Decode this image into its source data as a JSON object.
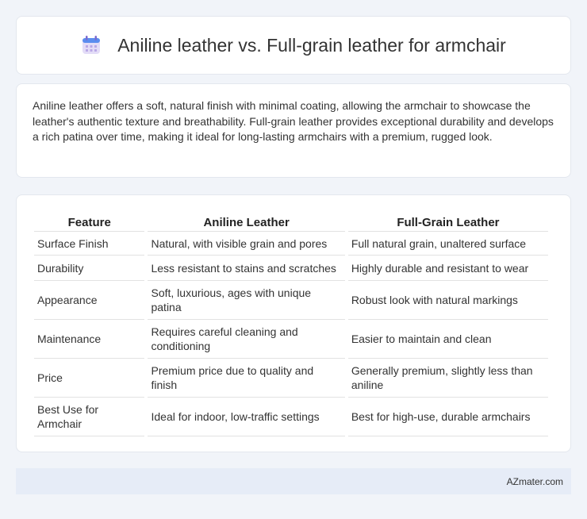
{
  "header": {
    "icon": "calendar-icon",
    "title": "Aniline leather vs. Full-grain leather for armchair"
  },
  "intro": {
    "text": "Aniline leather offers a soft, natural finish with minimal coating, allowing the armchair to showcase the leather's authentic texture and breathability. Full-grain leather provides exceptional durability and develops a rich patina over time, making it ideal for long-lasting armchairs with a premium, rugged look."
  },
  "table": {
    "headers": [
      "Feature",
      "Aniline Leather",
      "Full-Grain Leather"
    ],
    "rows": [
      [
        "Surface Finish",
        "Natural, with visible grain and pores",
        "Full natural grain, unaltered surface"
      ],
      [
        "Durability",
        "Less resistant to stains and scratches",
        "Highly durable and resistant to wear"
      ],
      [
        "Appearance",
        "Soft, luxurious, ages with unique patina",
        "Robust look with natural markings"
      ],
      [
        "Maintenance",
        "Requires careful cleaning and conditioning",
        "Easier to maintain and clean"
      ],
      [
        "Price",
        "Premium price due to quality and finish",
        "Generally premium, slightly less than aniline"
      ],
      [
        "Best Use for Armchair",
        "Ideal for indoor, low-traffic settings",
        "Best for high-use, durable armchairs"
      ]
    ]
  },
  "footer": {
    "brand": "AZmater.com"
  },
  "colors": {
    "background": "#f1f4f9",
    "footer_bg": "#e6ecf7",
    "icon_purple": "#b9a8e6",
    "icon_blue": "#5b8def"
  }
}
